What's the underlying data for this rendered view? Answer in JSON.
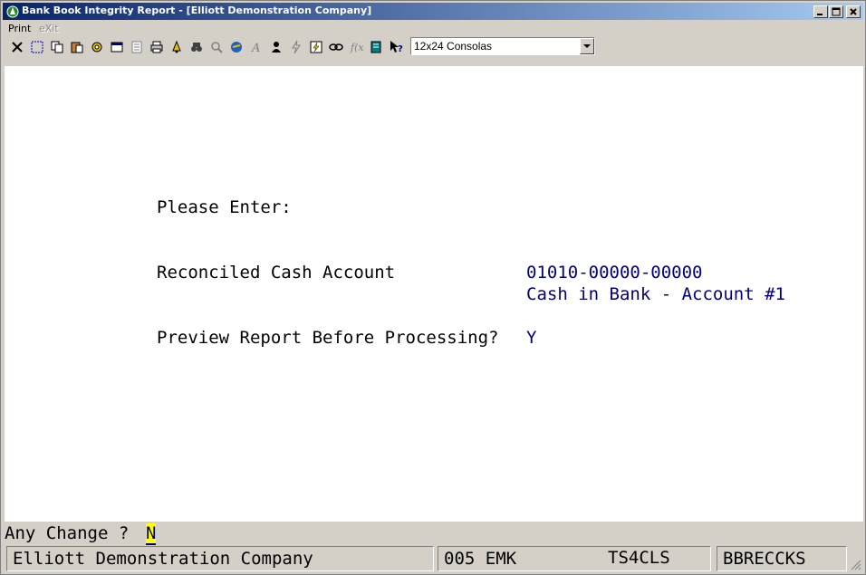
{
  "window": {
    "title": "Bank Book Integrity Report - [Elliott Demonstration Company]"
  },
  "menu": {
    "items": [
      {
        "label": "Print",
        "enabled": true
      },
      {
        "label": "eXit",
        "enabled": false
      }
    ]
  },
  "toolbar": {
    "icons": [
      "close-icon",
      "select-icon",
      "copy-icon",
      "paste-icon",
      "settings-icon",
      "properties-icon",
      "notepad-icon",
      "print-icon",
      "bell-icon",
      "binoculars-icon",
      "magnify-icon",
      "internet-icon",
      "font-icon",
      "user-icon",
      "lightning-icon",
      "macro-icon",
      "link-icon",
      "function-icon",
      "book-icon",
      "help-pointer-icon"
    ],
    "font_select": "12x24 Consolas"
  },
  "screen": {
    "heading": "Please Enter:",
    "account_label": "Reconciled Cash Account",
    "account_number": "01010-00000-00000",
    "account_name": "Cash in Bank - Account #1",
    "preview_label": "Preview Report Before Processing?",
    "preview_value": "Y"
  },
  "prompt": {
    "label": "Any Change ? ",
    "value": "N"
  },
  "status": {
    "company": "Elliott Demonstration Company",
    "user": "005 EMK",
    "terminal": "TS4CLS",
    "program": "BBRECCKS"
  }
}
